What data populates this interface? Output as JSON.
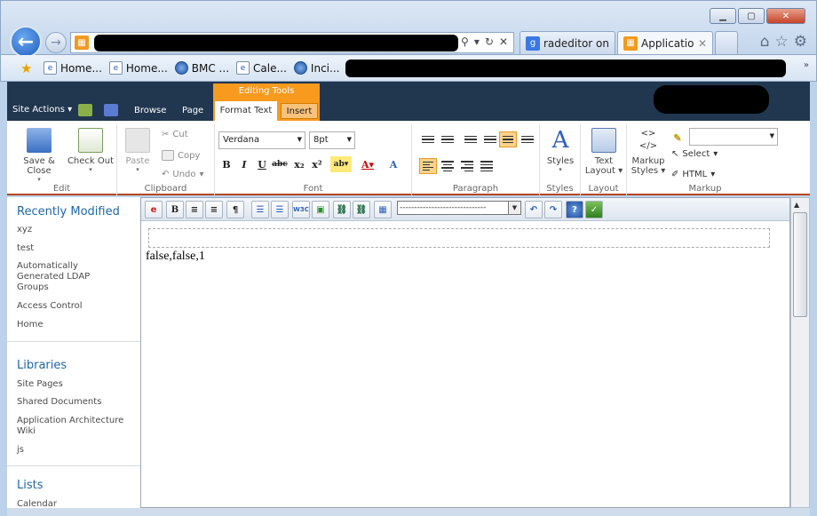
{
  "browser": {
    "tabs": [
      {
        "label": "radeditor on ...",
        "icon": "google-icon",
        "color": "#3b78e7"
      },
      {
        "label": "Applicatio...",
        "icon": "sharepoint-icon",
        "color": "#f29a1f"
      }
    ],
    "favorites": [
      {
        "label": "Home...",
        "icon": "page-icon"
      },
      {
        "label": "Home...",
        "icon": "page-icon"
      },
      {
        "label": "BMC ...",
        "icon": "globe-icon"
      },
      {
        "label": "Cale...",
        "icon": "page-icon"
      },
      {
        "label": "Inci...",
        "icon": "globe-icon"
      }
    ]
  },
  "sharepoint": {
    "site_actions": "Site Actions",
    "tabs": {
      "browse": "Browse",
      "page": "Page"
    },
    "editing_tools": "Editing Tools",
    "format_text": "Format Text",
    "insert": "Insert"
  },
  "ribbon": {
    "edit": {
      "save_close": "Save & Close",
      "check_out": "Check Out",
      "label": "Edit"
    },
    "clipboard": {
      "paste": "Paste",
      "cut": "Cut",
      "copy": "Copy",
      "undo": "Undo",
      "label": "Clipboard"
    },
    "font": {
      "family": "Verdana",
      "size": "8pt",
      "label": "Font"
    },
    "paragraph": {
      "label": "Paragraph"
    },
    "styles": {
      "button": "Styles",
      "label": "Styles"
    },
    "layout": {
      "text_layout_1": "Text",
      "text_layout_2": "Layout",
      "label": "Layout"
    },
    "markup": {
      "markup_styles_1": "Markup",
      "markup_styles_2": "Styles",
      "select": "Select",
      "html": "HTML",
      "label": "Markup"
    }
  },
  "nav": {
    "recently_modified": "Recently Modified",
    "recent_items": [
      "xyz",
      "test",
      "Automatically Generated LDAP Groups",
      "Access Control",
      "Home"
    ],
    "libraries": "Libraries",
    "library_items": [
      "Site Pages",
      "Shared Documents",
      "Application Architecture Wiki",
      "js"
    ],
    "lists": "Lists",
    "list_items": [
      "Calendar"
    ]
  },
  "editor": {
    "format_dropdown": "------------------------------",
    "content": "false,false,1"
  }
}
